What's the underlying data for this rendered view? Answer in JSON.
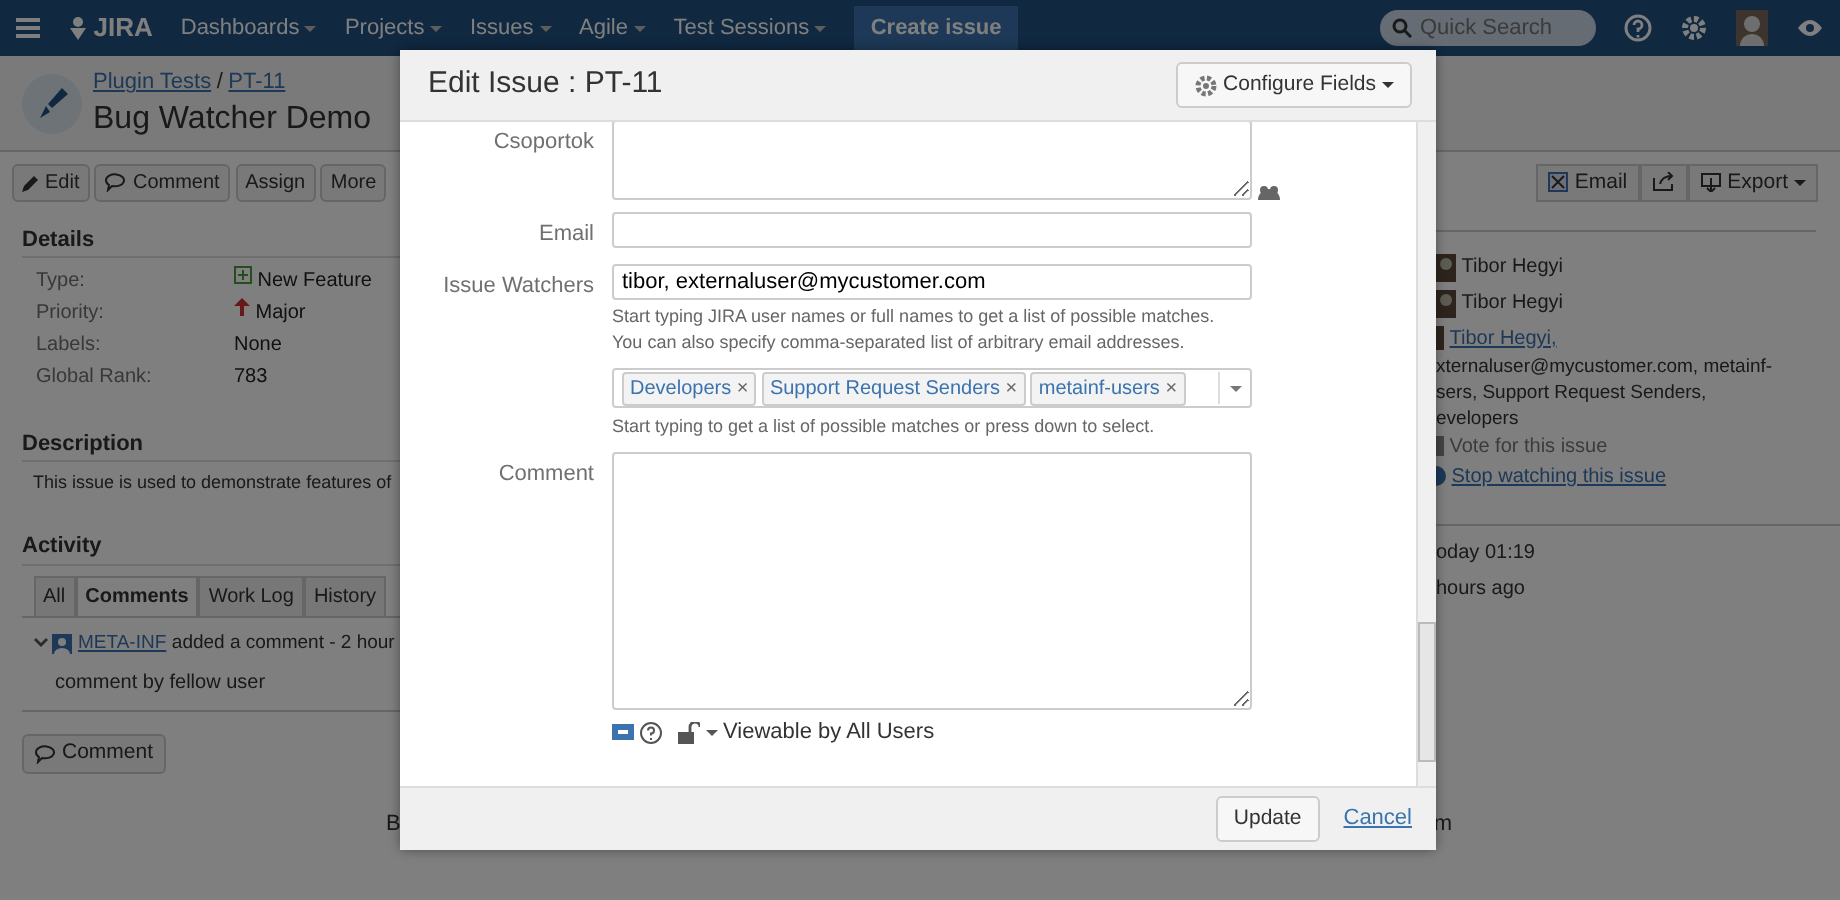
{
  "navbar": {
    "items": [
      {
        "label": "Dashboards"
      },
      {
        "label": "Projects"
      },
      {
        "label": "Issues"
      },
      {
        "label": "Agile"
      },
      {
        "label": "Test Sessions"
      }
    ],
    "logo": "JIRA",
    "create_button": "Create issue",
    "search": {
      "placeholder": "Quick Search"
    }
  },
  "issue_header": {
    "project": "Plugin Tests",
    "separator": "/",
    "key": "PT-11",
    "title": "Bug Watcher Demo"
  },
  "toolbar": [
    {
      "label": "Edit",
      "kind": "edit"
    },
    {
      "label": "Comment",
      "kind": "comment"
    },
    {
      "label": "Assign",
      "kind": "plain"
    },
    {
      "label": "More",
      "kind": "plain"
    }
  ],
  "right_toolbar": [
    {
      "label": "Email",
      "kind": "email"
    },
    {
      "kind": "share"
    },
    {
      "label": "Export",
      "kind": "export"
    }
  ],
  "details": {
    "heading": "Details",
    "fields": [
      {
        "label": "Type:",
        "value": "New Feature",
        "kind": "type"
      },
      {
        "label": "Priority:",
        "value": "Major",
        "kind": "priority"
      },
      {
        "label": "Labels:",
        "value": "None",
        "kind": "plain"
      },
      {
        "label": "Global Rank:",
        "value": "783",
        "kind": "plain"
      }
    ]
  },
  "description": {
    "heading": "Description",
    "text": "This issue is used to demonstrate features of"
  },
  "activity": {
    "heading": "Activity",
    "tabs": [
      {
        "label": "All",
        "selected": false
      },
      {
        "label": "Comments",
        "selected": true
      },
      {
        "label": "Work Log",
        "selected": false
      },
      {
        "label": "History",
        "selected": false
      }
    ],
    "comment": {
      "author": "META-INF",
      "action": "added a comment - 2 hour",
      "body": "comment by fellow user"
    },
    "comment_button": "Comment"
  },
  "people": [
    {
      "name": "Tibor Hegyi"
    },
    {
      "name": "Tibor Hegyi"
    }
  ],
  "watchers": {
    "link": "Tibor Hegyi,",
    "lines": [
      "xternaluser@mycustomer.com, metainf-",
      "sers, Support Request Senders,",
      "evelopers"
    ]
  },
  "vote": "Vote for this issue",
  "watch": "Stop watching this issue",
  "dates": [
    "oday 01:19",
    "hours ago"
  ],
  "footer": [
    "B",
    "m"
  ],
  "dialog": {
    "title": "Edit Issue : PT-11",
    "configure": "Configure Fields",
    "fields": [
      {
        "kind": "textarea",
        "label": "Csoportok",
        "picker": true
      },
      {
        "kind": "input",
        "label": "Email"
      },
      {
        "kind": "input",
        "label": "Issue Watchers",
        "value": "tibor, externaluser@mycustomer.com",
        "help": [
          "Start typing JIRA user names or full names to get a list of possible matches.",
          "You can also specify comma-separated list of arbitrary email addresses."
        ]
      },
      {
        "kind": "multiselect",
        "tags": [
          {
            "label": "Developers",
            "remove": "×"
          },
          {
            "label": "Support Request Senders",
            "remove": "×"
          },
          {
            "label": "metainf-users",
            "remove": "×"
          }
        ],
        "help": [
          "Start typing to get a list of possible matches or press down to select."
        ]
      },
      {
        "kind": "textarea",
        "label": "Comment",
        "visibility": "Viewable by All Users"
      }
    ],
    "buttons": {
      "submit": "Update",
      "cancel": "Cancel"
    }
  }
}
